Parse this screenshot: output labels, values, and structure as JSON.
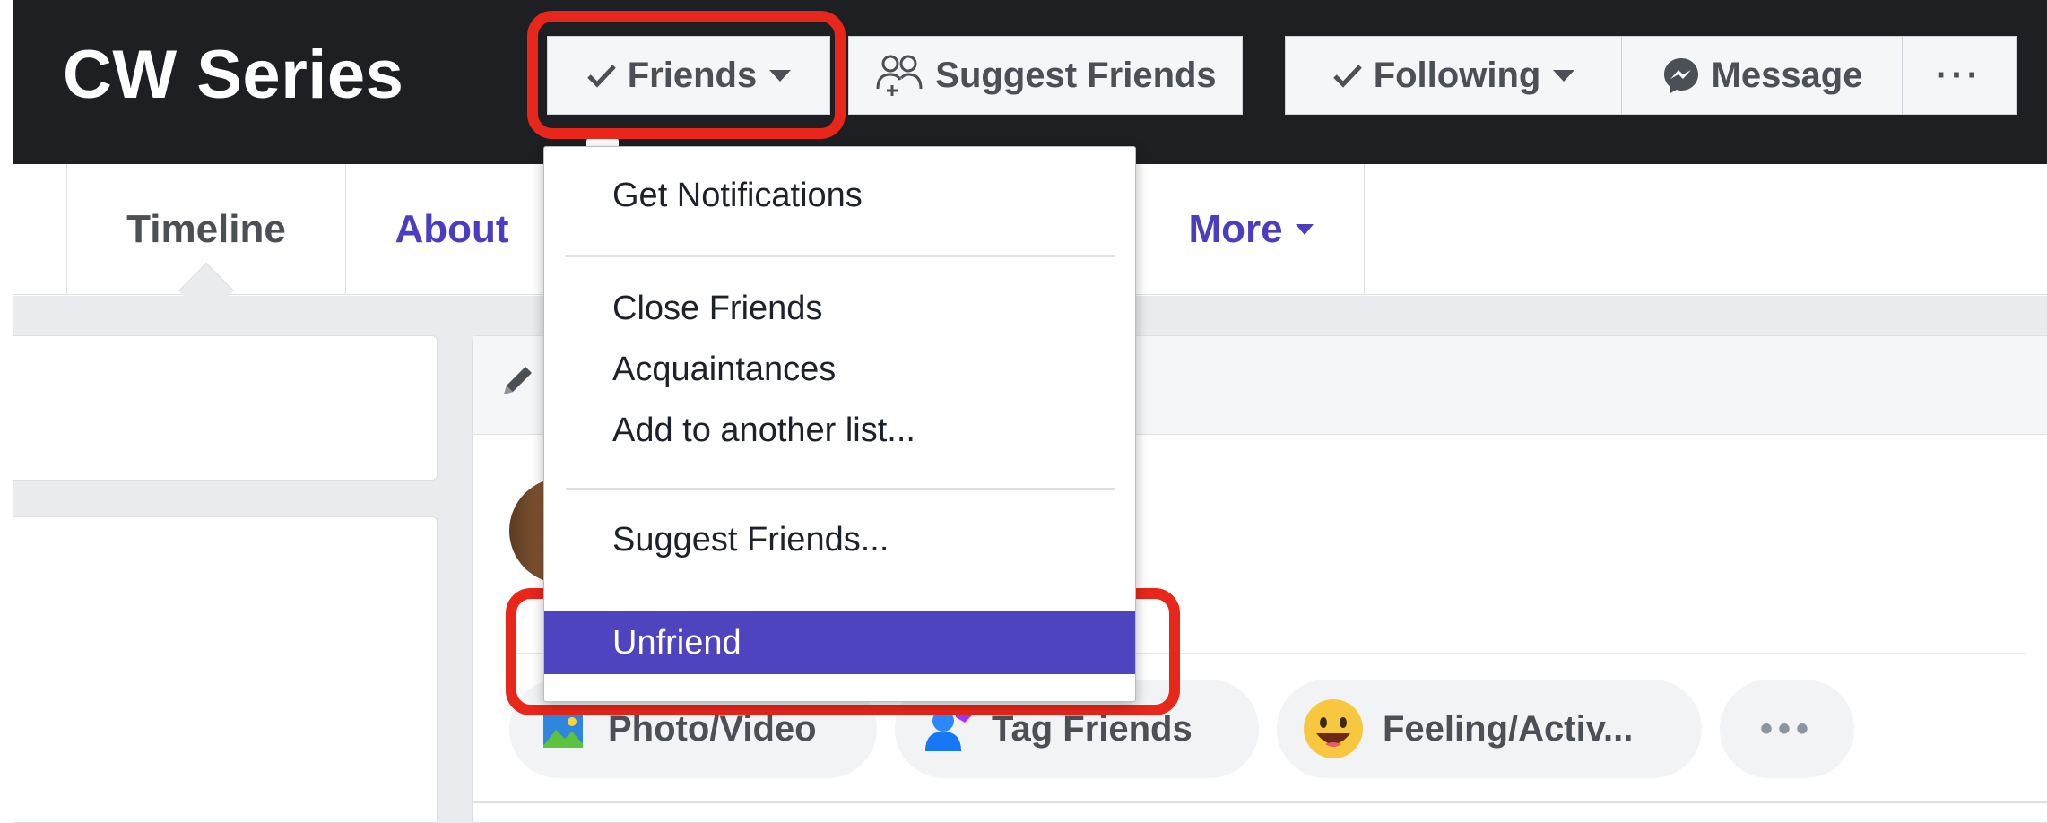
{
  "header": {
    "page_title": "CW Series",
    "friends_label": "Friends",
    "suggest_friends_label": "Suggest Friends",
    "following_label": "Following",
    "message_label": "Message",
    "more_label": "···"
  },
  "tabs": {
    "timeline": "Timeline",
    "about": "About",
    "more": "More"
  },
  "dropdown": {
    "items": [
      "Get Notifications",
      "Close Friends",
      "Acquaintances",
      "Add to another list...",
      "Suggest Friends...",
      "Unfriend"
    ],
    "highlighted": "Unfriend"
  },
  "composer": {
    "photo_video": "Photo/Video",
    "tag_friends": "Tag Friends",
    "feeling": "Feeling/Activ...",
    "more": "•••"
  },
  "colors": {
    "header_bg": "#1e1f22",
    "accent": "#4b3dbf",
    "menu_highlight": "#4f44c0",
    "annotation_red": "#e8261a"
  }
}
